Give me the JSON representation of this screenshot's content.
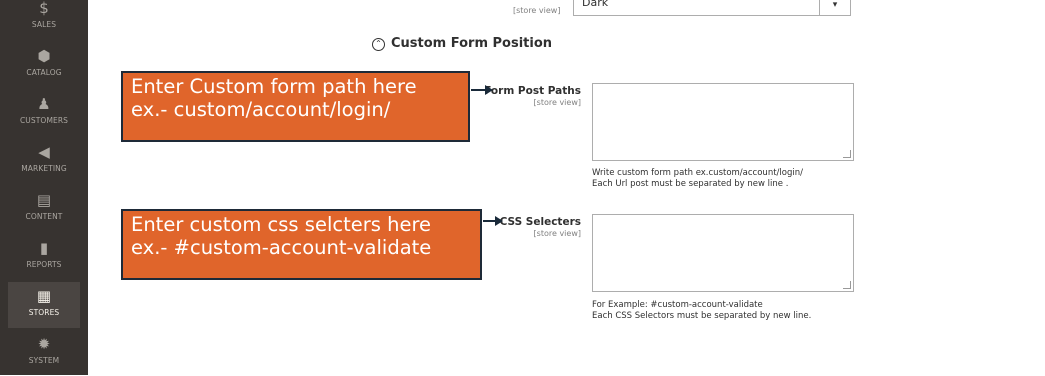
{
  "sidebar": {
    "items": [
      {
        "label": "SALES",
        "icon": "dollar-icon",
        "glyph": "$"
      },
      {
        "label": "CATALOG",
        "icon": "cube-icon",
        "glyph": "⬢"
      },
      {
        "label": "CUSTOMERS",
        "icon": "person-icon",
        "glyph": "♟"
      },
      {
        "label": "MARKETING",
        "icon": "megaphone-icon",
        "glyph": "◀"
      },
      {
        "label": "CONTENT",
        "icon": "layout-icon",
        "glyph": "▤"
      },
      {
        "label": "REPORTS",
        "icon": "bar-chart-icon",
        "glyph": "▮"
      },
      {
        "label": "STORES",
        "icon": "storefront-icon",
        "glyph": "▦"
      },
      {
        "label": "SYSTEM",
        "icon": "gear-icon",
        "glyph": "✹"
      }
    ],
    "active": "STORES"
  },
  "top_field": {
    "scope": "[store view]",
    "value": "Dark",
    "caret": "▾"
  },
  "section": {
    "title": "Custom Form Position",
    "toggle_glyph": "⌃"
  },
  "fields": {
    "form_post_paths": {
      "label": "Form Post Paths",
      "scope": "[store view]",
      "value": "",
      "note_line1": "Write custom form path ex.custom/account/login/",
      "note_line2": "Each Url post must be separated by new line ."
    },
    "css_selecters": {
      "label": "CSS Selecters",
      "scope": "[store view]",
      "value": "",
      "note_line1": "For Example: #custom-account-validate",
      "note_line2": "Each CSS Selectors must be separated by new line."
    }
  },
  "callouts": {
    "form_path": {
      "line1": "Enter Custom form path here",
      "line2": "ex.- custom/account/login/"
    },
    "css": {
      "line1": "Enter custom css selcters here",
      "line2": "ex.- #custom-account-validate"
    }
  },
  "colors": {
    "sidebar_bg": "#373330",
    "callout_bg": "#e0652b",
    "callout_border": "#1e2a38"
  }
}
